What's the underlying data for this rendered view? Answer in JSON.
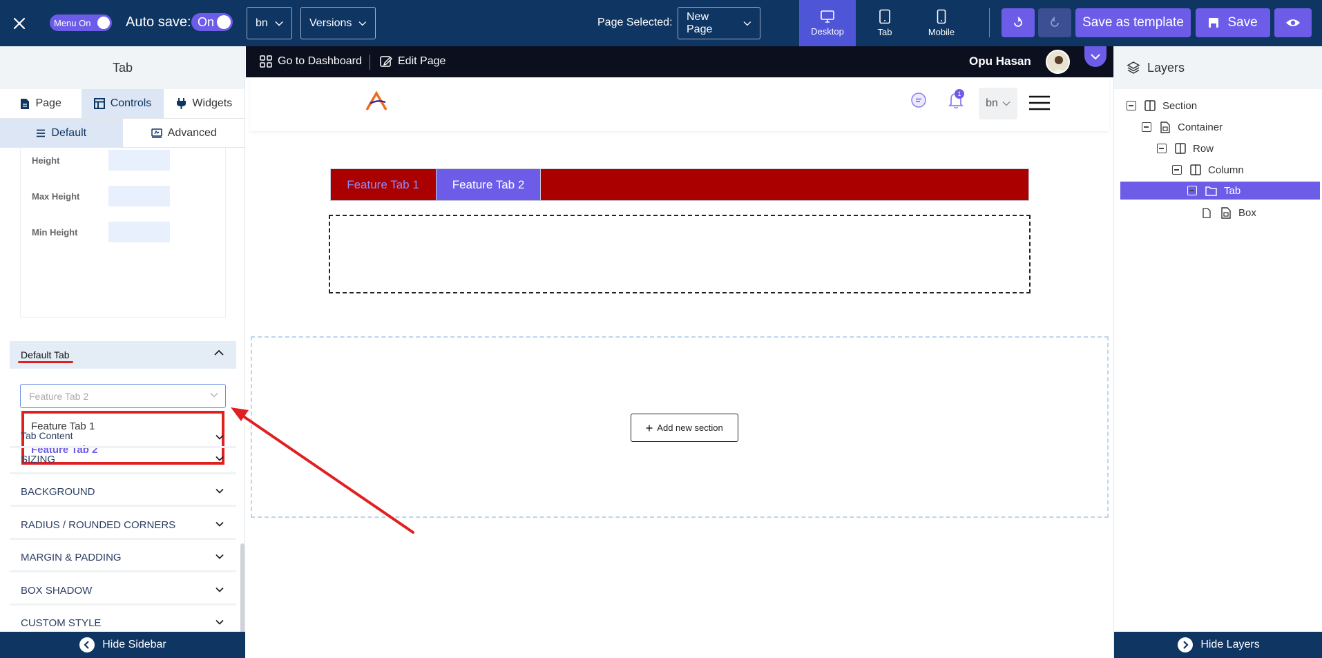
{
  "topbar": {
    "menu_toggle_label": "Menu On",
    "autosave_label": "Auto save:",
    "autosave_value": "On",
    "language": "bn",
    "versions_label": "Versions",
    "page_selected_label": "Page Selected:",
    "page_selected_value": "New Page",
    "devices": [
      {
        "label": "Desktop",
        "icon": "desktop-icon",
        "active": true
      },
      {
        "label": "Tab",
        "icon": "tablet-icon",
        "active": false
      },
      {
        "label": "Mobile",
        "icon": "mobile-icon",
        "active": false
      }
    ],
    "save_template_label": "Save as template",
    "save_label": "Save",
    "accent_color": "#6d5ce8",
    "bar_color": "#0f3563"
  },
  "left": {
    "title": "Tab",
    "main_tabs": [
      {
        "label": "Page",
        "icon": "document-icon"
      },
      {
        "label": "Controls",
        "icon": "layout-icon",
        "active": true
      },
      {
        "label": "Widgets",
        "icon": "plug-icon"
      }
    ],
    "sub_tabs": [
      {
        "label": "Default",
        "icon": "list-icon",
        "active": true
      },
      {
        "label": "Advanced",
        "icon": "advanced-icon"
      }
    ],
    "size_fields": [
      {
        "label": "Height",
        "value": ""
      },
      {
        "label": "Max Height",
        "value": ""
      },
      {
        "label": "Min Height",
        "value": ""
      }
    ],
    "default_tab_section": {
      "label": "Default Tab",
      "selected": "Feature Tab 2",
      "options": [
        "Feature Tab 1",
        "Feature Tab 2"
      ]
    },
    "sections": [
      "Tab Content",
      "SIZING",
      "BACKGROUND",
      "RADIUS / ROUNDED CORNERS",
      "MARGIN & PADDING",
      "BOX SHADOW",
      "CUSTOM STYLE"
    ],
    "hide_sidebar_label": "Hide Sidebar"
  },
  "canvas": {
    "admin_bar": {
      "dashboard_label": "Go to Dashboard",
      "edit_label": "Edit Page",
      "user_name": "Opu Hasan"
    },
    "header": {
      "notification_count": "1",
      "language": "bn"
    },
    "tabs": [
      {
        "label": "Feature Tab 1",
        "active": false
      },
      {
        "label": "Feature Tab 2",
        "active": true
      }
    ],
    "tab_strip_color": "#aa0000",
    "add_section_label": "Add new section"
  },
  "layers": {
    "title": "Layers",
    "tree": [
      {
        "label": "Section",
        "icon": "columns-icon",
        "depth": 0
      },
      {
        "label": "Container",
        "icon": "container-icon",
        "depth": 1
      },
      {
        "label": "Row",
        "icon": "columns-icon",
        "depth": 2
      },
      {
        "label": "Column",
        "icon": "columns-icon",
        "depth": 3
      },
      {
        "label": "Tab",
        "icon": "folder-icon",
        "depth": 4,
        "selected": true
      },
      {
        "label": "Box",
        "icon": "container-icon",
        "depth": 5
      }
    ],
    "hide_layers_label": "Hide Layers"
  }
}
